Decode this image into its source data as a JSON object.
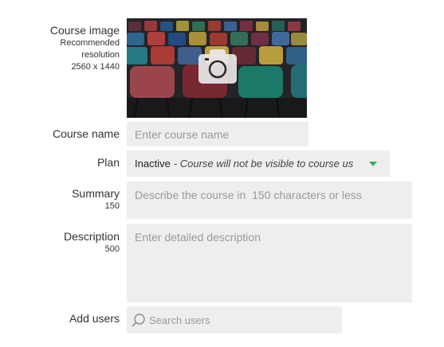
{
  "course_image": {
    "label": "Course image",
    "hint_line1": "Recommended",
    "hint_line2": "resolution",
    "hint_line3": "2560 x 1440",
    "overlay_icon": "camera-icon"
  },
  "course_name": {
    "label": "Course name",
    "placeholder": "Enter course name",
    "value": ""
  },
  "plan": {
    "label": "Plan",
    "status": "Inactive",
    "description": "- Course will not be visible to course users",
    "dropdown_icon": "caret-down-icon",
    "accent_color": "#3dae5e"
  },
  "summary": {
    "label": "Summary",
    "limit": "150",
    "placeholder": "Describe the course in  150 characters or less",
    "value": ""
  },
  "description": {
    "label": "Description",
    "limit": "500",
    "placeholder": "Enter detailed description",
    "value": ""
  },
  "add_users": {
    "label": "Add users",
    "placeholder": "Search users",
    "icon": "search-icon"
  },
  "colors": {
    "field_background": "#eeeeee",
    "placeholder": "#9a9a9a",
    "text": "#333333"
  }
}
